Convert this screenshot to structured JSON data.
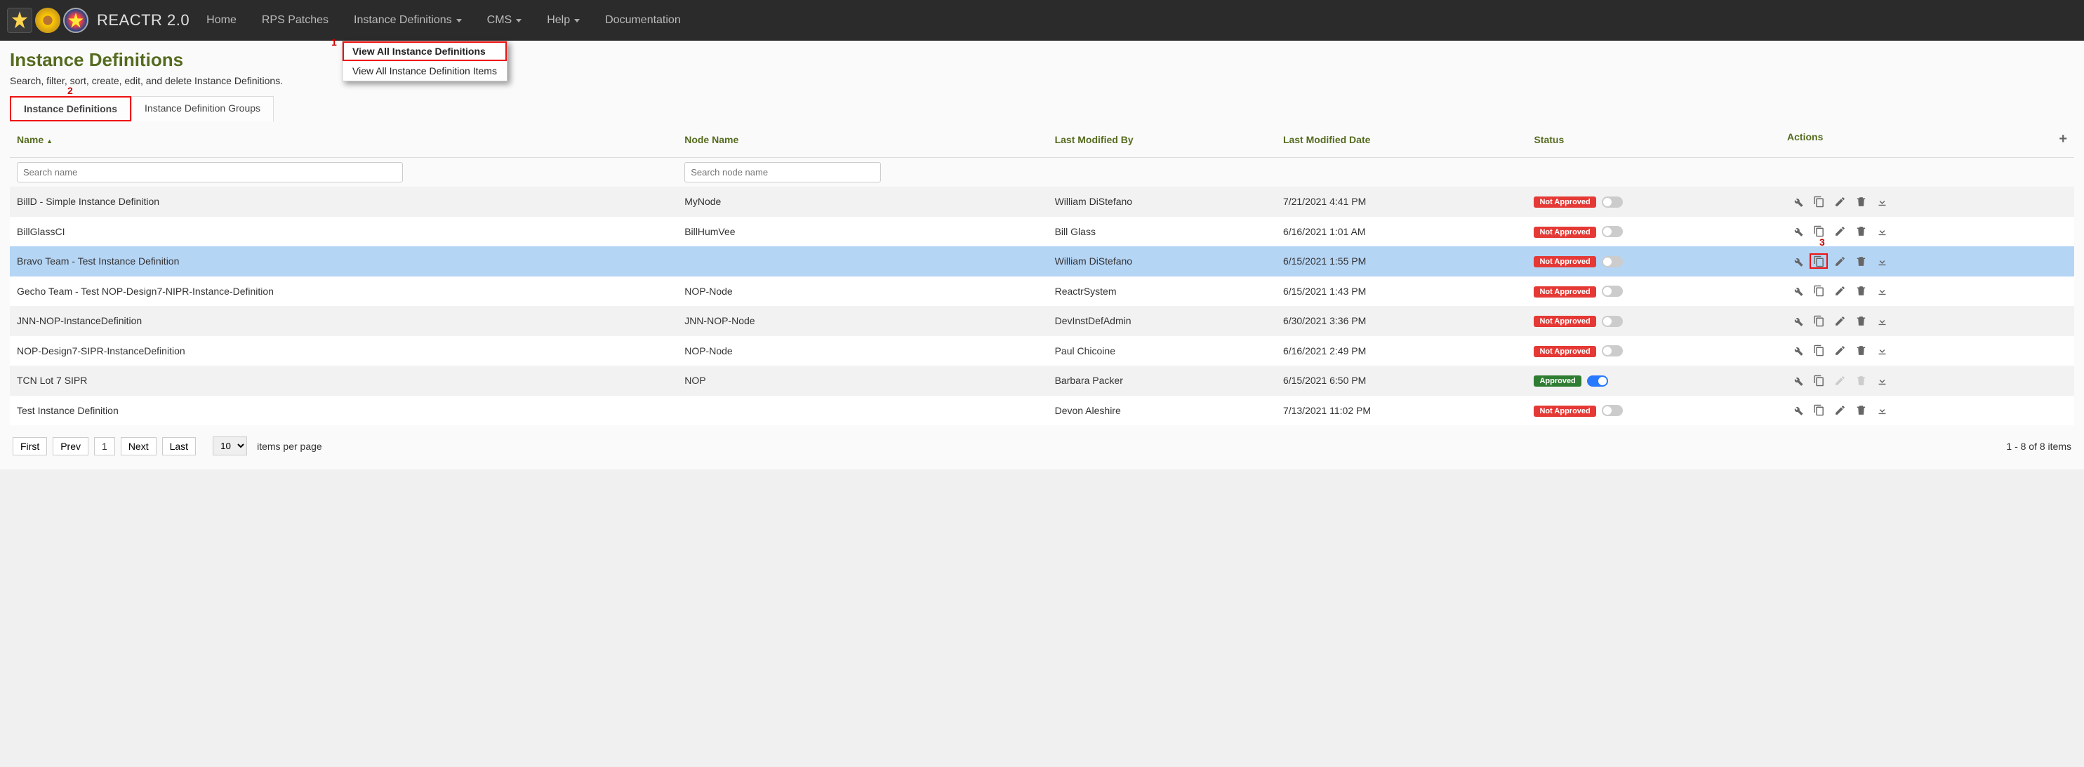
{
  "brand": "REACTR 2.0",
  "nav": {
    "home": "Home",
    "rps": "RPS Patches",
    "instdef": "Instance Definitions",
    "cms": "CMS",
    "help": "Help",
    "docs": "Documentation"
  },
  "dropdown": {
    "viewAll": "View All Instance Definitions",
    "viewItems": "View All Instance Definition Items"
  },
  "callouts": {
    "one": "1",
    "two": "2",
    "three": "3"
  },
  "page": {
    "title": "Instance Definitions",
    "subtitle": "Search, filter, sort, create, edit, and delete Instance Definitions."
  },
  "tabs": {
    "defs": "Instance Definitions",
    "groups": "Instance Definition Groups"
  },
  "columns": {
    "name": "Name",
    "node": "Node Name",
    "modby": "Last Modified By",
    "moddate": "Last Modified Date",
    "status": "Status",
    "actions": "Actions"
  },
  "filters": {
    "name_ph": "Search name",
    "node_ph": "Search node name"
  },
  "status_labels": {
    "not_approved": "Not Approved",
    "approved": "Approved"
  },
  "rows": [
    {
      "name": "BillD - Simple Instance Definition",
      "node": "MyNode",
      "modby": "William DiStefano",
      "moddate": "7/21/2021 4:41 PM",
      "status": "not_approved",
      "approved_toggle": false,
      "selected": false
    },
    {
      "name": "BillGlassCI",
      "node": "BillHumVee",
      "modby": "Bill Glass",
      "moddate": "6/16/2021 1:01 AM",
      "status": "not_approved",
      "approved_toggle": false,
      "selected": false
    },
    {
      "name": "Bravo Team - Test Instance Definition",
      "node": "",
      "modby": "William DiStefano",
      "moddate": "6/15/2021 1:55 PM",
      "status": "not_approved",
      "approved_toggle": false,
      "selected": true
    },
    {
      "name": "Gecho Team - Test NOP-Design7-NIPR-Instance-Definition",
      "node": "NOP-Node",
      "modby": "ReactrSystem",
      "moddate": "6/15/2021 1:43 PM",
      "status": "not_approved",
      "approved_toggle": false,
      "selected": false
    },
    {
      "name": "JNN-NOP-InstanceDefinition",
      "node": "JNN-NOP-Node",
      "modby": "DevInstDefAdmin",
      "moddate": "6/30/2021 3:36 PM",
      "status": "not_approved",
      "approved_toggle": false,
      "selected": false
    },
    {
      "name": "NOP-Design7-SIPR-InstanceDefinition",
      "node": "NOP-Node",
      "modby": "Paul Chicoine",
      "moddate": "6/16/2021 2:49 PM",
      "status": "not_approved",
      "approved_toggle": false,
      "selected": false
    },
    {
      "name": "TCN Lot 7 SIPR",
      "node": "NOP",
      "modby": "Barbara Packer",
      "moddate": "6/15/2021 6:50 PM",
      "status": "approved",
      "approved_toggle": true,
      "selected": false
    },
    {
      "name": "Test Instance Definition",
      "node": "",
      "modby": "Devon Aleshire",
      "moddate": "7/13/2021 11:02 PM",
      "status": "not_approved",
      "approved_toggle": false,
      "selected": false
    }
  ],
  "pager": {
    "first": "First",
    "prev": "Prev",
    "page": "1",
    "next": "Next",
    "last": "Last",
    "page_size": "10",
    "page_size_label": "items per page",
    "range": "1 - 8 of 8 items"
  }
}
